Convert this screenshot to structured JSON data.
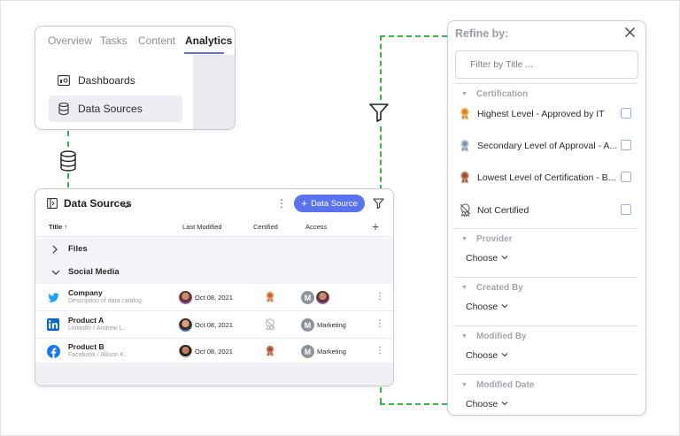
{
  "nav": {
    "tabs": [
      {
        "label": "Overview",
        "active": false
      },
      {
        "label": "Tasks",
        "active": false
      },
      {
        "label": "Content",
        "active": false
      },
      {
        "label": "Analytics",
        "active": true
      }
    ],
    "menu": [
      {
        "label": "Dashboards",
        "icon": "dashboard-icon",
        "selected": false
      },
      {
        "label": "Data Sources",
        "icon": "database-icon",
        "selected": true
      }
    ]
  },
  "data_sources": {
    "title": "Data Sources",
    "add_button": "Data Source",
    "columns": {
      "title": "Title ↑",
      "last_modified": "Last Modified",
      "certified": "Certified",
      "access": "Access"
    },
    "groups": [
      {
        "label": "Files",
        "expanded": false
      },
      {
        "label": "Social Media",
        "expanded": true
      }
    ],
    "rows": [
      {
        "name": "Company",
        "desc": "Description of data catalog",
        "icon": "twitter-icon",
        "date": "Oct 08, 2021",
        "cert": "highest",
        "access_badge": "M",
        "access_text": ""
      },
      {
        "name": "Product A",
        "desc": "LinkedIn / Andrew L.",
        "icon": "linkedin-icon",
        "date": "Oct 08, 2021",
        "cert": "none",
        "access_badge": "M",
        "access_text": "Marketing"
      },
      {
        "name": "Product B",
        "desc": "Facebook / Allison K.",
        "icon": "facebook-icon",
        "date": "Oct 08, 2021",
        "cert": "lowest",
        "access_badge": "M",
        "access_text": "Marketing"
      }
    ]
  },
  "refine": {
    "title": "Refine by:",
    "search_placeholder": "Filter by Title ...",
    "certification": {
      "label": "Certification",
      "options": [
        {
          "label": "Highest Level - Approved by IT",
          "medal": "gold"
        },
        {
          "label": "Secondary Level of Approval - A...",
          "medal": "silver"
        },
        {
          "label": "Lowest Level of Certification - B...",
          "medal": "bronze"
        },
        {
          "label": "Not Certified",
          "medal": "none"
        }
      ]
    },
    "sections": [
      {
        "label": "Provider",
        "value": "Choose"
      },
      {
        "label": "Created By",
        "value": "Choose"
      },
      {
        "label": "Modified By",
        "value": "Choose"
      },
      {
        "label": "Modified Date",
        "value": "Choose"
      }
    ]
  },
  "colors": {
    "accent": "#5b72ee",
    "connector": "#39b54a",
    "twitter": "#1da1f2",
    "linkedin": "#0a66c2",
    "facebook": "#1877f2"
  }
}
